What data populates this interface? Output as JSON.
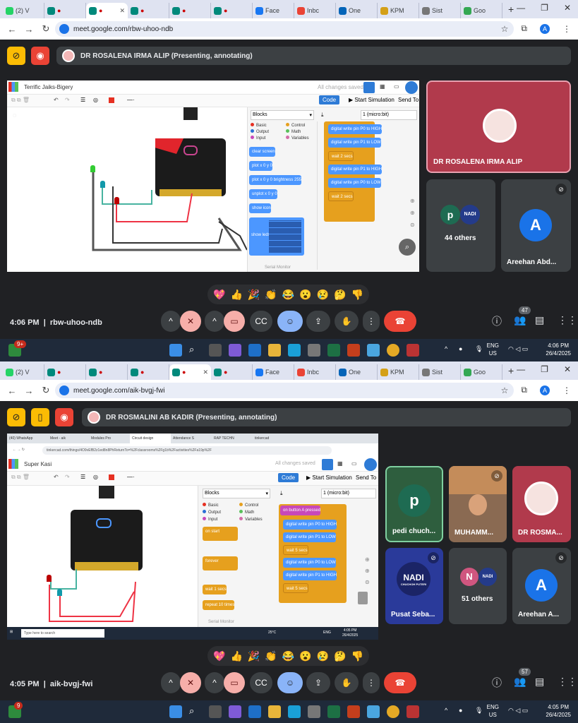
{
  "top": {
    "tabs": [
      "(2) V",
      "",
      "",
      "",
      "",
      "",
      "Face",
      "Inbc",
      "One",
      "KPM",
      "Sist",
      "Goo"
    ],
    "url": "meet.google.com/rbw-uhoo-ndb",
    "presenter_bar": "DR ROSALENA IRMA ALIP (Presenting, annotating)",
    "project_name": "Terrific Jaiks-Bigery",
    "saved": "All changes saved",
    "code_btn": "Code",
    "sim_btn": "Start Simulation",
    "send_btn": "Send To",
    "blocks_dd": "Blocks",
    "device_dd": "1 (micro:bit)",
    "categories": [
      "Basic",
      "Output",
      "Input",
      "Control",
      "Math",
      "Variables"
    ],
    "cat_colors": [
      "#e63022",
      "#2a6fd6",
      "#c848b9",
      "#e6a01e",
      "#59c059",
      "#d36ca8"
    ],
    "palette_blocks": [
      "clear screen",
      "plot x 0 y 0",
      "plot x 0 y 0 brightness 255",
      "unplot x 0 y 0",
      "show icon",
      "show leds"
    ],
    "code_blocks": [
      "digital write pin P0 to HIGH",
      "digital write pin P1 to LOW",
      "wait 2 secs",
      "digital write pin P1 to HIGH",
      "digital write pin P0 to LOW",
      "wait 2 secs"
    ],
    "serial": "Serial Monitor",
    "tiles": [
      {
        "name": "DR ROSALENA IRMA ALIP"
      },
      {
        "name": "44 others",
        "letter": "p"
      },
      {
        "name": "Areehan Abd...",
        "letter": "A"
      }
    ],
    "nadi": "NADI",
    "reactions": [
      "💖",
      "👍",
      "🎉",
      "👏",
      "😂",
      "😮",
      "😢",
      "🤔",
      "👎"
    ],
    "time": "4:06 PM",
    "code": "rbw-uhoo-ndb",
    "people_count": "47",
    "taskbar_lang": "ENG",
    "taskbar_region": "US",
    "taskbar_time": "4:06 PM",
    "taskbar_date": "26/4/2025",
    "notif": "9+"
  },
  "bottom": {
    "tabs": [
      "(2) V",
      "",
      "",
      "",
      "",
      "",
      "Face",
      "Inbc",
      "One",
      "KPM",
      "Sist",
      "Goo"
    ],
    "url": "meet.google.com/aik-bvgj-fwi",
    "presenter_bar": "DR ROSMALINI AB KADIR (Presenting, annotating)",
    "inner_tabs": [
      "(40) WhatsApp",
      "Meet - aik",
      "Modules Pro",
      "Circuit design",
      "Attendance S",
      "RAP TECHN",
      "tinkercad"
    ],
    "inner_url": "tinkercad.com/things/4O9vEfB2z1ed8n8PhReturnTo=%2Fclassrooms%2Fg1b%2Factivities%2Fa19p%2F",
    "project_name": "Super Kasi",
    "saved": "All changes saved",
    "code_btn": "Code",
    "sim_btn": "Start Simulation",
    "send_btn": "Send To",
    "blocks_dd": "Blocks",
    "device_dd": "1 (micro:bit)",
    "categories": [
      "Basic",
      "Output",
      "Input",
      "Control",
      "Math",
      "Variables"
    ],
    "code_blocks": [
      "on button A pressed",
      "digital write pin P0 to HIGH",
      "digital write pin P1 to LOW",
      "wait 5 secs",
      "digital write pin P0 to LOW",
      "digital write pin P1 to HIGH",
      "wait 5 secs"
    ],
    "palette_blocks": [
      "on start",
      "forever",
      "wait 1 secs",
      "repeat 10 times"
    ],
    "serial": "Serial Monitor",
    "inner_search": "Type here to search",
    "inner_temp": "25°C",
    "inner_lang": "ENG",
    "inner_time": "4:05 PM",
    "inner_date": "26/4/2025",
    "tiles": [
      {
        "name": "pedi chuch...",
        "letter": "p"
      },
      {
        "name": "MUHAMM..."
      },
      {
        "name": "DR ROSMA..."
      },
      {
        "name": "Pusat Seba..."
      },
      {
        "name": "51 others",
        "letter": "N"
      },
      {
        "name": "Areehan A...",
        "letter": "A"
      }
    ],
    "nadi": "NADI",
    "nadi_sub": "CHUCHOH PUTERI",
    "reactions": [
      "💖",
      "👍",
      "🎉",
      "👏",
      "😂",
      "😮",
      "😢",
      "🤔",
      "👎"
    ],
    "time": "4:05 PM",
    "code": "aik-bvgj-fwi",
    "people_count": "57",
    "taskbar_lang": "ENG",
    "taskbar_region": "US",
    "taskbar_time": "4:05 PM",
    "taskbar_date": "26/4/2025",
    "notif": "9"
  },
  "colors": {
    "meet_bg": "#202124",
    "tile": "#3c4043",
    "hangup": "#ea4335",
    "mute": "#f6aea9",
    "accent": "#1a73e8",
    "tinker_blue": "#4c97ff"
  }
}
